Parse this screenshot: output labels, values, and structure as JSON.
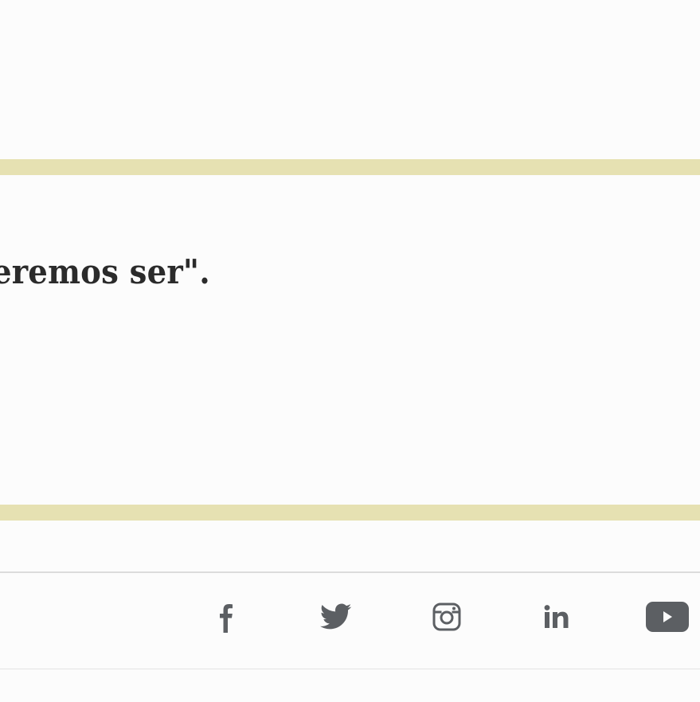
{
  "quote": {
    "text": "eremos ser\"."
  },
  "social": {
    "items": [
      {
        "name": "facebook",
        "icon": "facebook-icon"
      },
      {
        "name": "twitter",
        "icon": "twitter-icon"
      },
      {
        "name": "instagram",
        "icon": "instagram-icon"
      },
      {
        "name": "linkedin",
        "icon": "linkedin-icon"
      },
      {
        "name": "youtube",
        "icon": "youtube-icon"
      }
    ]
  },
  "colors": {
    "background": "#fcfcfc",
    "accent_band": "#e6e1b2",
    "text": "#2b2b2b",
    "icon": "#5c5f63",
    "rule": "#dcdcdc"
  }
}
